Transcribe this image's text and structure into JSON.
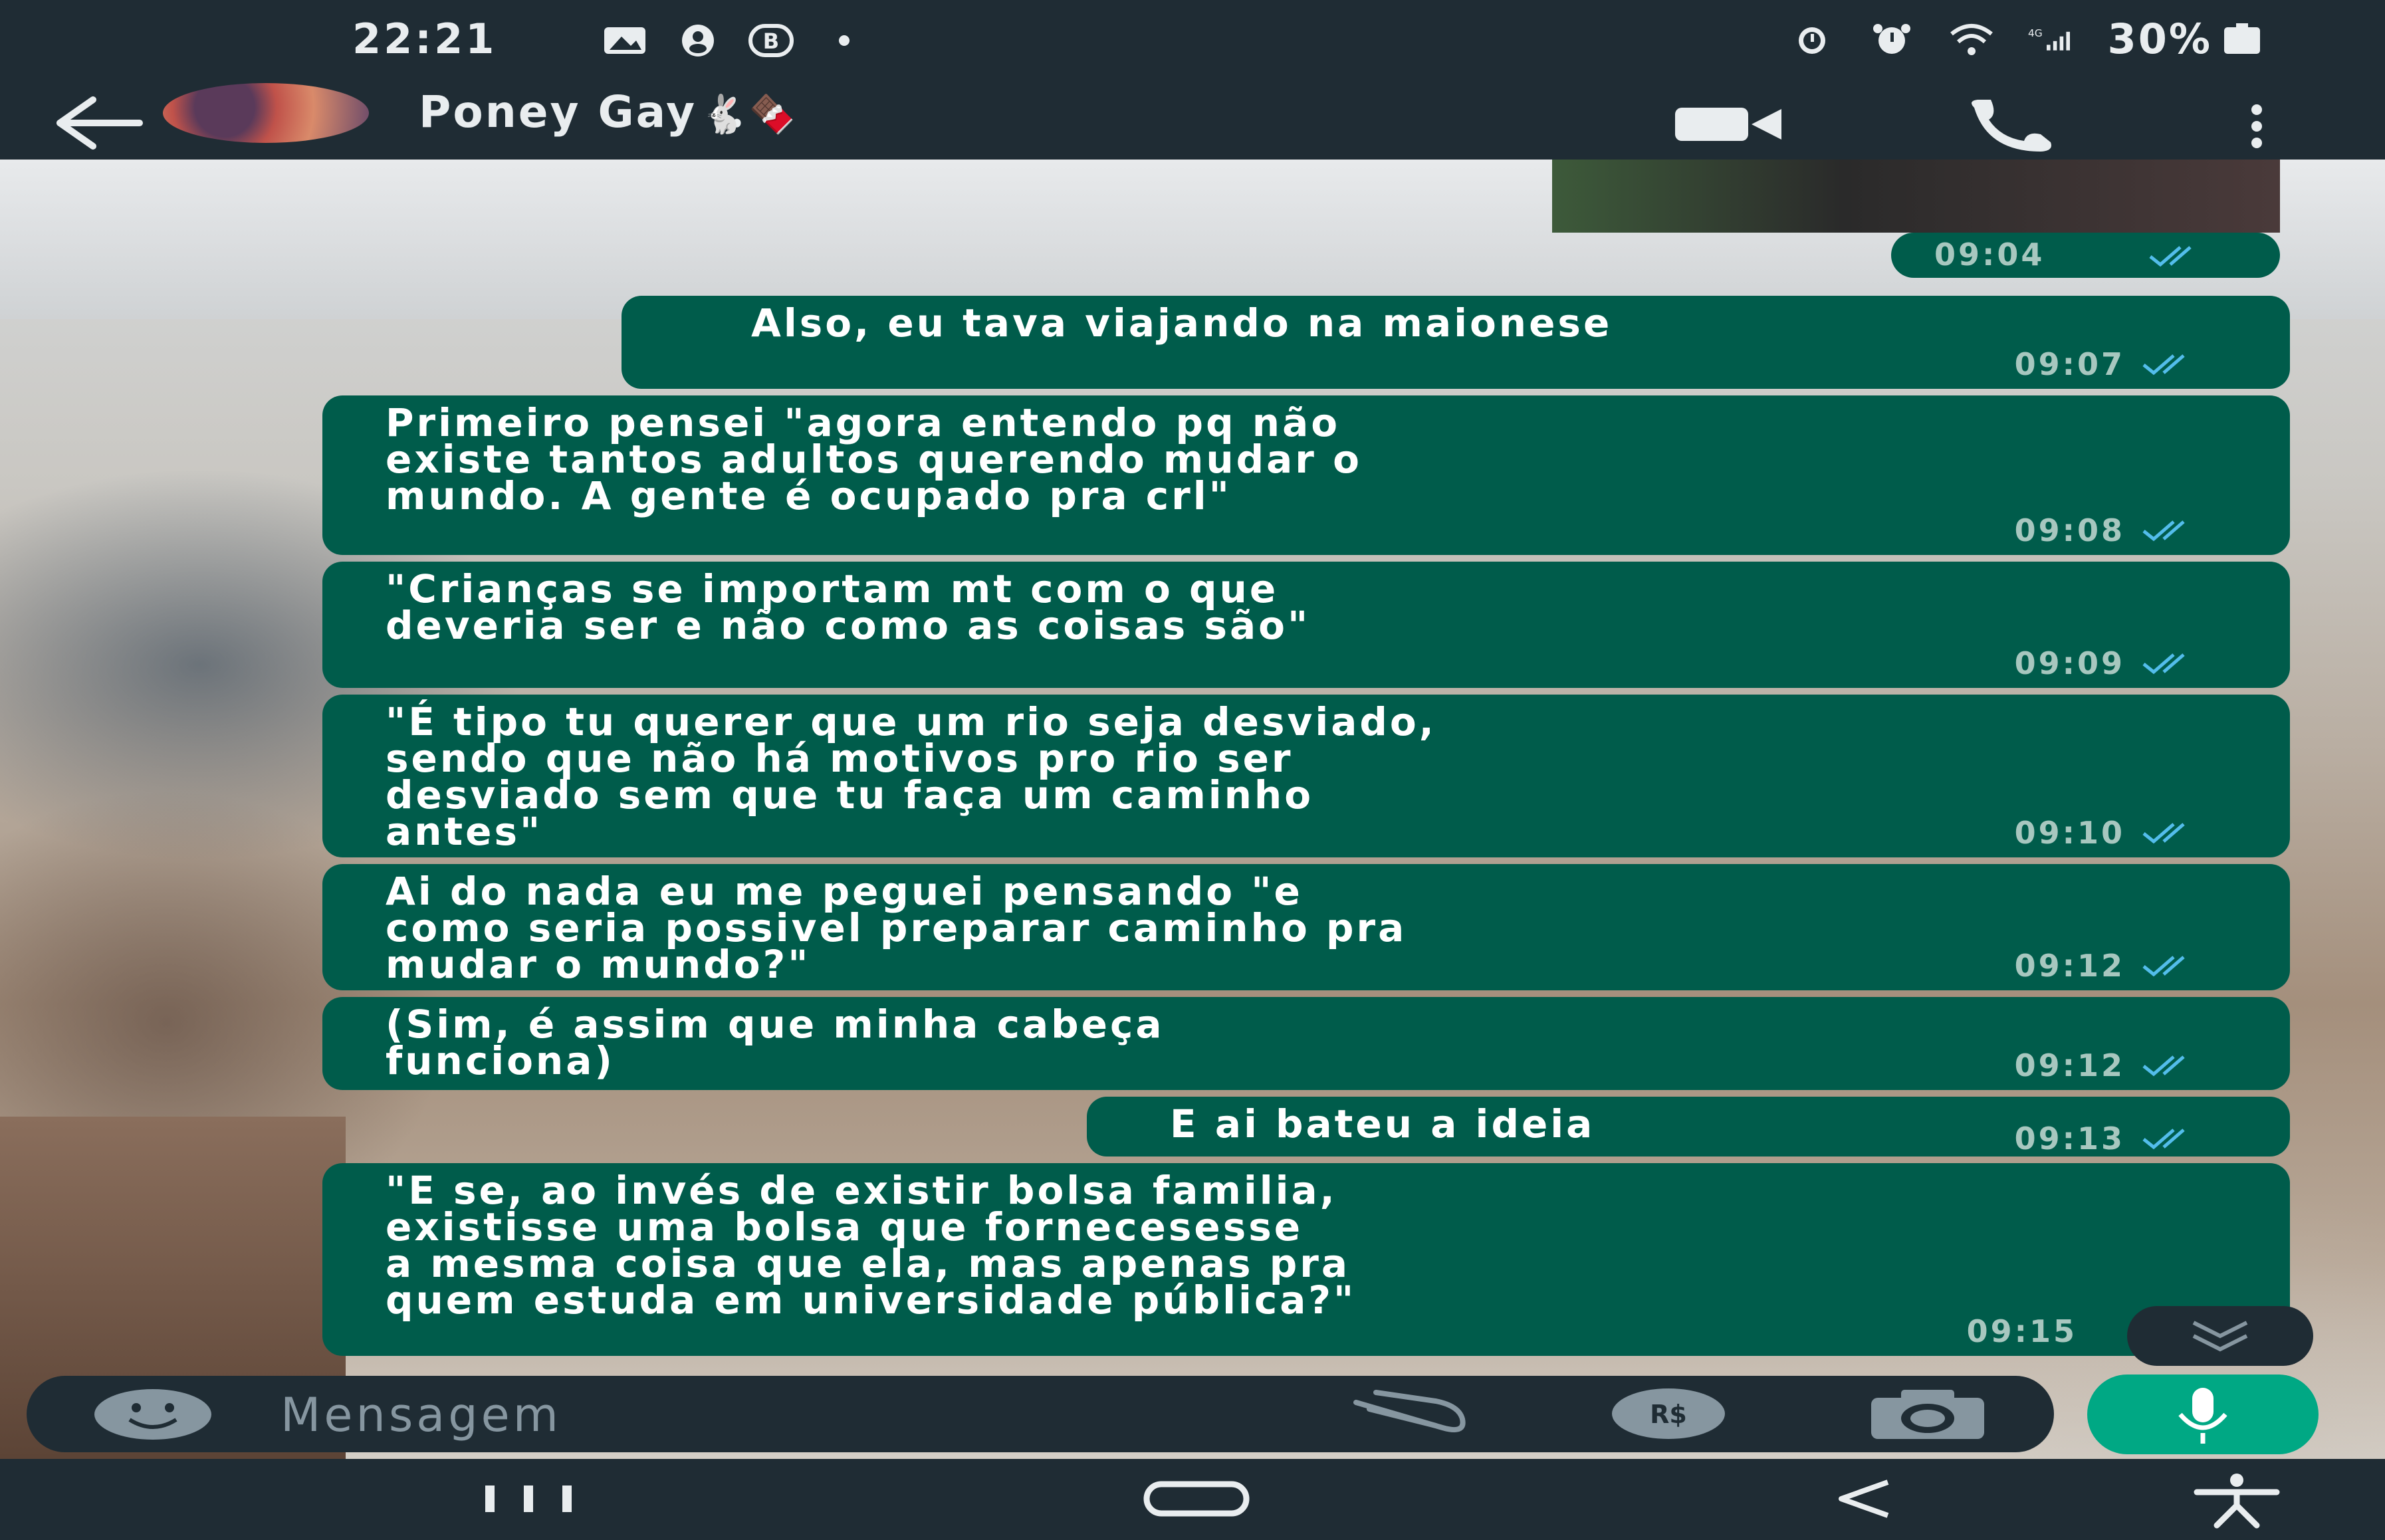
{
  "status_bar": {
    "time": "22:21",
    "battery": "30%",
    "network": "4G"
  },
  "header": {
    "contact_name": "Poney Gay",
    "contact_emoji": "🐇🍫"
  },
  "messages": [
    {
      "text": "Also, eu tava viajando na maionese",
      "time": "09:07"
    },
    {
      "text": "Primeiro pensei \"agora entendo pq não\nexiste tantos adultos querendo mudar o\nmundo. A gente é ocupado pra crl\"",
      "time": "09:08"
    },
    {
      "text": "\"Crianças se importam mt com o que\ndeveria ser e não como as coisas são\"",
      "time": "09:09"
    },
    {
      "text": "\"É tipo tu querer que um rio seja desviado,\nsendo que não há motivos pro rio ser\ndesviado sem que tu faça um caminho\nantes\"",
      "time": "09:10"
    },
    {
      "text": "Ai do nada eu me peguei pensando \"e\ncomo seria possivel preparar caminho pra\nmudar o mundo?\"",
      "time": "09:12"
    },
    {
      "text": "(Sim, é assim que minha cabeça\nfunciona)",
      "time": "09:12"
    },
    {
      "text": "E ai bateu a ideia",
      "time": "09:13"
    },
    {
      "text": "\"E se, ao invés de existir bolsa familia,\nexistisse uma bolsa que fornecesesse\na mesma coisa que ela, mas apenas pra\nquem estuda em universidade pública?\"",
      "time": "09:15"
    }
  ],
  "previous_media": {
    "time": "09:04"
  },
  "composer": {
    "placeholder": "Mensagem"
  },
  "colors": {
    "bubble_outgoing": "#005c4b",
    "bar_background": "#1f2c34",
    "accent": "#00a884",
    "read_ticks": "#53bdeb"
  }
}
